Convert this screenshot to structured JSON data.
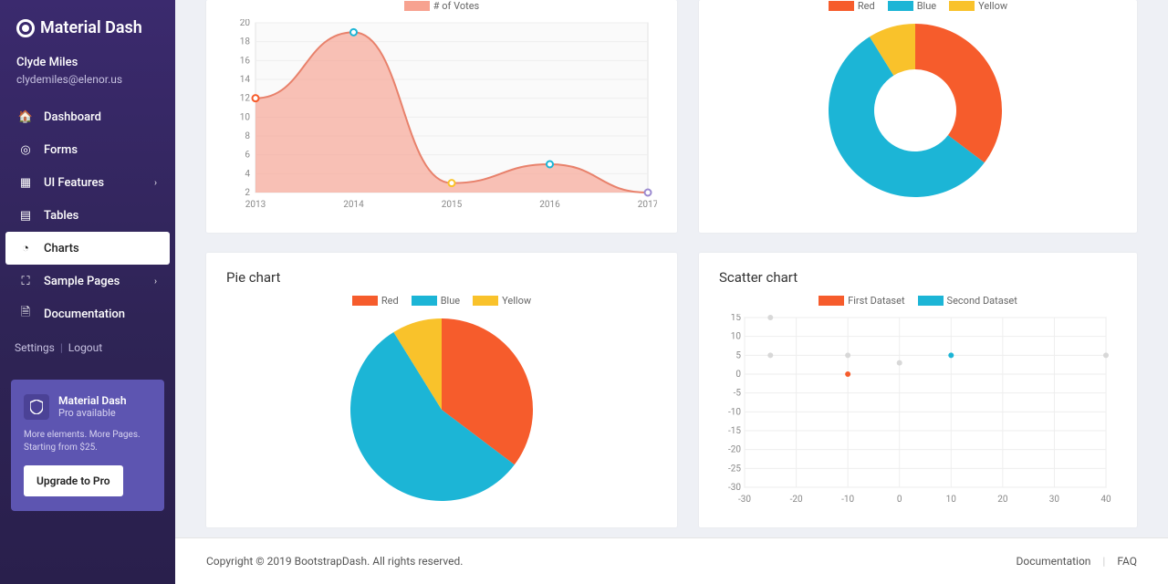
{
  "brand": "Material Dash",
  "user": {
    "name": "Clyde Miles",
    "email": "clydemiles@elenor.us"
  },
  "nav": {
    "dashboard": "Dashboard",
    "forms": "Forms",
    "ui": "UI Features",
    "tables": "Tables",
    "charts": "Charts",
    "sample": "Sample Pages",
    "docs": "Documentation"
  },
  "links": {
    "settings": "Settings",
    "logout": "Logout"
  },
  "promo": {
    "title": "Material Dash",
    "sub": "Pro available",
    "text": "More elements. More Pages. Starting from $25.",
    "cta": "Upgrade to Pro"
  },
  "cards": {
    "pie": "Pie chart",
    "scatter": "Scatter chart"
  },
  "legend": {
    "votes": "# of Votes",
    "red": "Red",
    "blue": "Blue",
    "yellow": "Yellow",
    "first": "First Dataset",
    "second": "Second Dataset"
  },
  "colors": {
    "red": "#f65c2c",
    "blue": "#1cb5d6",
    "yellow": "#f9c22b",
    "area": "#f7a290"
  },
  "footer": {
    "copy": "Copyright © 2019 BootstrapDash. All rights reserved.",
    "docs": "Documentation",
    "faq": "FAQ"
  },
  "chart_data": [
    {
      "type": "area",
      "title": "# of Votes",
      "x": [
        "2013",
        "2014",
        "2015",
        "2016",
        "2017"
      ],
      "values": [
        12,
        19,
        3,
        5,
        2
      ],
      "ylim": [
        2,
        20
      ],
      "ylabel": "",
      "xlabel": ""
    },
    {
      "type": "doughnut",
      "title": "",
      "labels": [
        "Red",
        "Blue",
        "Yellow"
      ],
      "values": [
        12,
        19,
        3
      ],
      "colors": [
        "#f65c2c",
        "#1cb5d6",
        "#f9c22b"
      ]
    },
    {
      "type": "pie",
      "title": "Pie chart",
      "labels": [
        "Red",
        "Blue",
        "Yellow"
      ],
      "values": [
        12,
        19,
        3
      ],
      "colors": [
        "#f65c2c",
        "#1cb5d6",
        "#f9c22b"
      ]
    },
    {
      "type": "scatter",
      "title": "Scatter chart",
      "xlim": [
        -30,
        40
      ],
      "ylim": [
        -30,
        15
      ],
      "xlabel": "",
      "ylabel": "",
      "series": [
        {
          "name": "First Dataset",
          "color": "#f65c2c",
          "points": [
            [
              -10,
              0
            ]
          ]
        },
        {
          "name": "Second Dataset",
          "color": "#1cb5d6",
          "points": [
            [
              10,
              5
            ]
          ]
        },
        {
          "name": "_faded",
          "color": "#d8d8d8",
          "points": [
            [
              -25,
              15
            ],
            [
              -25,
              5
            ],
            [
              -10,
              5
            ],
            [
              0,
              3
            ],
            [
              40,
              5
            ]
          ]
        }
      ]
    }
  ]
}
